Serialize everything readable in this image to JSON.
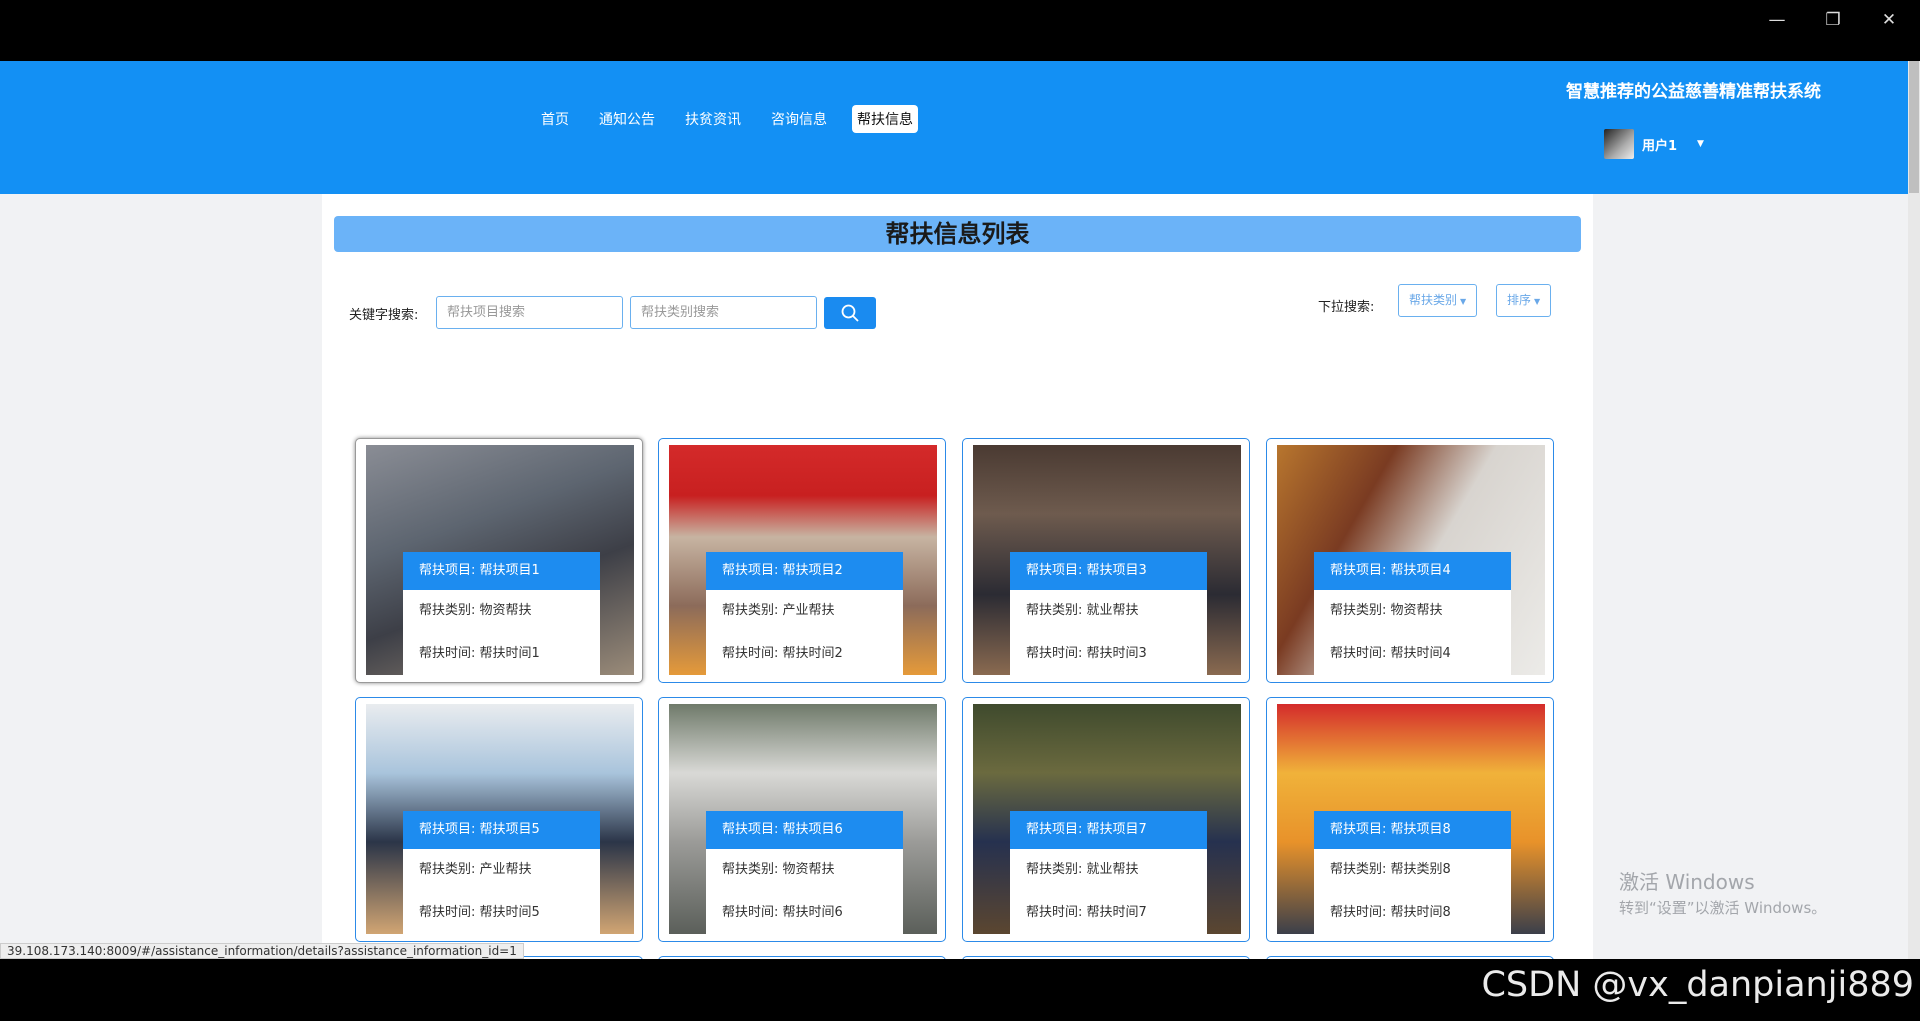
{
  "window": {
    "minimize_icon": "minimize-icon",
    "restore_icon": "restore-icon",
    "close_icon": "close-icon"
  },
  "header": {
    "nav": [
      "首页",
      "通知公告",
      "扶贫资讯",
      "咨询信息",
      "帮扶信息"
    ],
    "active_nav": "帮扶信息",
    "system_title": "智慧推荐的公益慈善精准帮扶系统",
    "user_name": "用户1",
    "brand_color": "#1390f4"
  },
  "main": {
    "list_title": "帮扶信息列表",
    "keyword_label": "关键字搜索:",
    "project_placeholder": "帮扶项目搜索",
    "category_placeholder": "帮扶类别搜索",
    "dropdown_label": "下拉搜索:",
    "category_dropdown": "帮扶类别",
    "sort_dropdown": "排序"
  },
  "cards": [
    {
      "project": "帮扶项目: 帮扶项目1",
      "category": "帮扶类别: 物资帮扶",
      "time": "帮扶时间: 帮扶时间1"
    },
    {
      "project": "帮扶项目: 帮扶项目2",
      "category": "帮扶类别: 产业帮扶",
      "time": "帮扶时间: 帮扶时间2"
    },
    {
      "project": "帮扶项目: 帮扶项目3",
      "category": "帮扶类别: 就业帮扶",
      "time": "帮扶时间: 帮扶时间3"
    },
    {
      "project": "帮扶项目: 帮扶项目4",
      "category": "帮扶类别: 物资帮扶",
      "time": "帮扶时间: 帮扶时间4"
    },
    {
      "project": "帮扶项目: 帮扶项目5",
      "category": "帮扶类别: 产业帮扶",
      "time": "帮扶时间: 帮扶时间5"
    },
    {
      "project": "帮扶项目: 帮扶项目6",
      "category": "帮扶类别: 物资帮扶",
      "time": "帮扶时间: 帮扶时间6"
    },
    {
      "project": "帮扶项目: 帮扶项目7",
      "category": "帮扶类别: 就业帮扶",
      "time": "帮扶时间: 帮扶时间7"
    },
    {
      "project": "帮扶项目: 帮扶项目8",
      "category": "帮扶类别: 帮扶类别8",
      "time": "帮扶时间: 帮扶时间8"
    }
  ],
  "status_url": "39.108.173.140:8009/#/assistance_information/details?assistance_information_id=1",
  "activate_windows": {
    "line1": "激活 Windows",
    "line2": "转到“设置”以激活 Windows。"
  },
  "watermark": "CSDN @vx_danpianji889"
}
